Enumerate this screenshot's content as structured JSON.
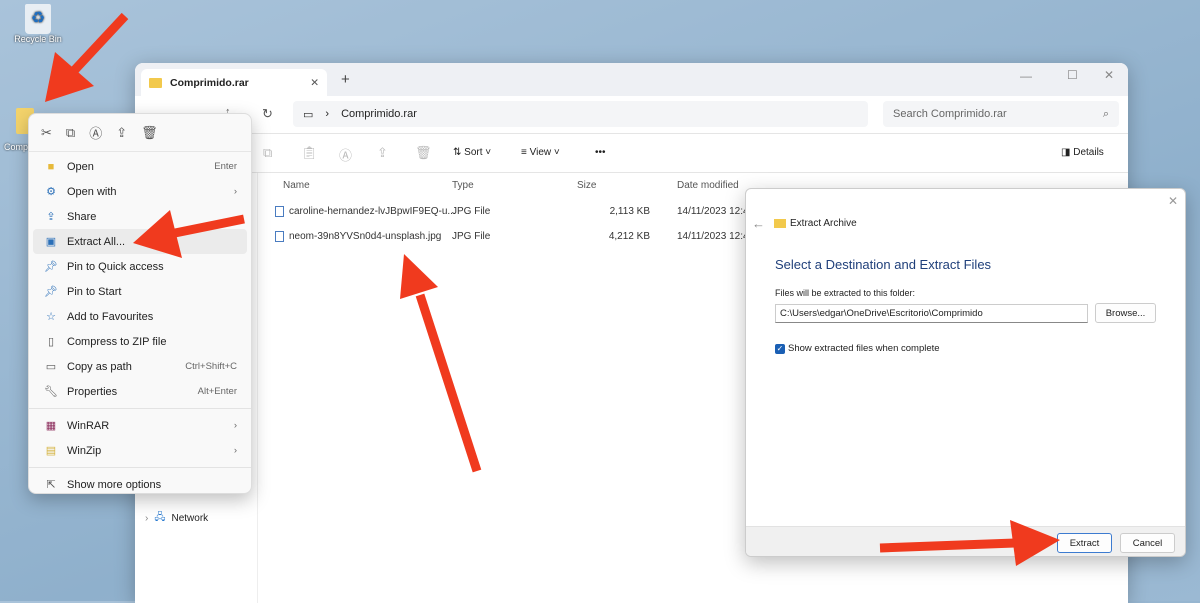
{
  "desktop": {
    "recycle_bin_label": "Recycle Bin",
    "archive_label": "Comprimido"
  },
  "explorer": {
    "tab_title": "Comprimido.rar",
    "new_tab": "+",
    "breadcrumb": "Comprimido.rar",
    "search_placeholder": "Search Comprimido.rar",
    "toolbar": {
      "sort": "Sort",
      "view": "View",
      "more": "•••",
      "details": "Details"
    },
    "columns": [
      "Name",
      "Type",
      "Size",
      "Date modified"
    ],
    "files": [
      {
        "name": "caroline-hernandez-lvJBpwIF9EQ-u...",
        "type": "JPG File",
        "size": "2,113 KB",
        "date": "14/11/2023 12:4"
      },
      {
        "name": "neom-39n8YVSn0d4-unsplash.jpg",
        "type": "JPG File",
        "size": "4,212 KB",
        "date": "14/11/2023 12:4"
      }
    ],
    "sidebar": {
      "network": "Network"
    }
  },
  "context_menu": {
    "top_icons": [
      "cut-icon",
      "copy-icon",
      "rename-icon",
      "share-icon",
      "delete-icon"
    ],
    "items": [
      {
        "label": "Open",
        "shortcut": "Enter"
      },
      {
        "label": "Open with",
        "submenu": true
      },
      {
        "label": "Share"
      },
      {
        "label": "Extract All...",
        "highlighted": true
      },
      {
        "label": "Pin to Quick access"
      },
      {
        "label": "Pin to Start"
      },
      {
        "label": "Add to Favourites"
      },
      {
        "label": "Compress to ZIP file"
      },
      {
        "label": "Copy as path",
        "shortcut": "Ctrl+Shift+C"
      },
      {
        "label": "Properties",
        "shortcut": "Alt+Enter"
      },
      {
        "label": "WinRAR",
        "submenu": true
      },
      {
        "label": "WinZip",
        "submenu": true
      },
      {
        "label": "Show more options"
      }
    ]
  },
  "dialog": {
    "title": "Extract Archive",
    "heading": "Select a Destination and Extract Files",
    "folder_label": "Files will be extracted to this folder:",
    "path": "C:\\Users\\edgar\\OneDrive\\Escritorio\\Comprimido",
    "browse": "Browse...",
    "checkbox_label": "Show extracted files when complete",
    "checkbox_checked": true,
    "extract": "Extract",
    "cancel": "Cancel"
  },
  "colors": {
    "annotation_arrow": "#f03a1e",
    "heading_blue": "#1f3f7a",
    "accent": "#1a5fb4"
  }
}
